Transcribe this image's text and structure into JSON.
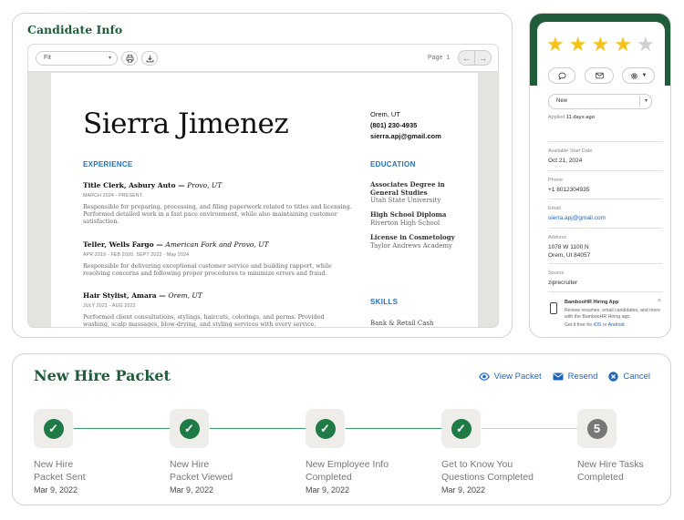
{
  "candidate_info": {
    "title": "Candidate Info",
    "viewer": {
      "zoom": "Fit",
      "page_label": "Page",
      "page_number": "1"
    },
    "resume": {
      "name": "Sierra Jimenez",
      "location": "Orem, UT",
      "phone": "(801) 230-4935",
      "email": "sierra.apj@gmail.com",
      "experience_heading": "EXPERIENCE",
      "jobs": [
        {
          "title": "Title Clerk, Asbury Auto — ",
          "place": "Provo, UT",
          "dates": "MARCH 2024 - PRESENT",
          "desc": "Responsible for preparing, processing, and filing paperwork related to titles and licensing. Performed detailed work in a fast pace environment, while also maintaining customer satisfaction."
        },
        {
          "title": "Teller, Wells Fargo — ",
          "place": "American Fork and Provo, UT",
          "dates": "APR 2019 - FEB 2020, SEPT 2022 - May 2024",
          "desc": "Responsible for delivering exceptional customer service and building rapport, while resolving concerns and following proper procedures to minimize errors and fraud."
        },
        {
          "title": "Hair Stylist, Amara — ",
          "place": "Orem, UT",
          "dates": "JULY 2021 - AUG 2022",
          "desc": "Performed client consultations, stylings, haircuts, colorings, and perms. Provided washing, scalp massages, blow-drying, and styling services with every service."
        }
      ],
      "education_heading": "EDUCATION",
      "education": [
        {
          "degree": "Associates Degree in General Studies",
          "school": "Utah State University"
        },
        {
          "degree": "High School Diploma",
          "school": "Riverton High School"
        },
        {
          "degree": "License in Cosmetology",
          "school": "Taylor Andrews Academy"
        }
      ],
      "skills_heading": "SKILLS",
      "skills": [
        "Bank & Retail Cash"
      ]
    }
  },
  "side_panel": {
    "rating": {
      "value": 4,
      "max": 5
    },
    "status": "New",
    "applied_prefix": "Applied",
    "applied_ago": "11 days ago",
    "fields": [
      {
        "label": "Available Start Date",
        "value": "Oct 21, 2024"
      },
      {
        "label": "Phone",
        "value": "+1 8012304935"
      },
      {
        "label": "Email",
        "value": "sierra.apj@gmail.com"
      },
      {
        "label": "Address",
        "value": "1078 W 1100 N",
        "value2": "Orem, Ut 84057"
      },
      {
        "label": "Source",
        "value": "ziprecruiter"
      }
    ],
    "promo": {
      "title": "BambooHR Hiring App",
      "desc": "Review resumes, email candidates, and more with the BambooHR Hiring app.",
      "free_prefix": "Get it free for",
      "ios": "iOS",
      "or": "or",
      "android": "Android",
      "close": "×"
    }
  },
  "new_hire_packet": {
    "title": "New Hire Packet",
    "actions": {
      "view": "View Packet",
      "resend": "Resend",
      "cancel": "Cancel"
    },
    "steps": [
      {
        "line1": "New Hire",
        "line2": "Packet Sent",
        "date": "Mar 9, 2022",
        "done": true
      },
      {
        "line1": "New Hire",
        "line2": "Packet Viewed",
        "date": "Mar 9, 2022",
        "done": true
      },
      {
        "line1": "New Employee Info",
        "line2": "Completed",
        "date": "Mar 9, 2022",
        "done": true
      },
      {
        "line1": "Get to Know You",
        "line2": "Questions Completed",
        "date": "Mar 9, 2022",
        "done": true
      },
      {
        "line1": "New Hire Tasks",
        "line2": "Completed",
        "date": "",
        "done": false,
        "number": "5"
      }
    ]
  },
  "colors": {
    "brand_green": "#1f5c3a",
    "check_green": "#1f7a45",
    "link_blue": "#1f65b8",
    "star_gold": "#f5c21b",
    "star_gray": "#cfcfcf"
  }
}
